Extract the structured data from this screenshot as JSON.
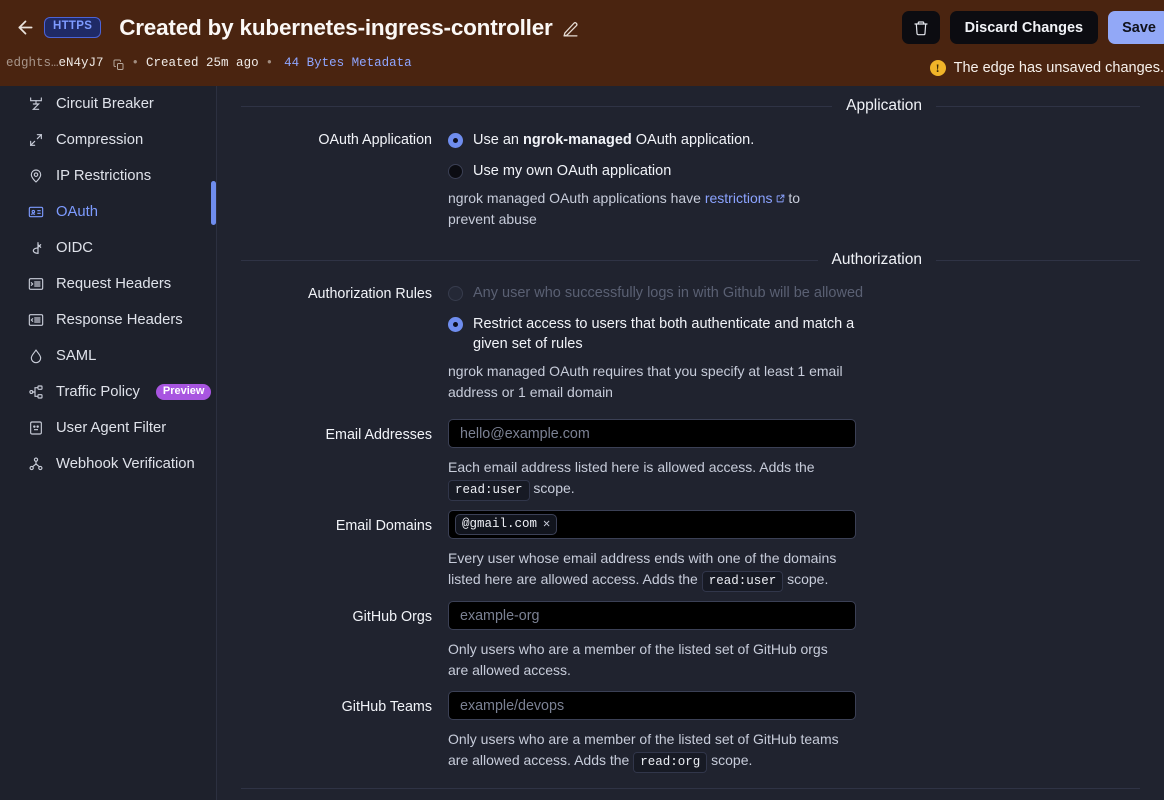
{
  "header": {
    "back_icon": "arrow-left-icon",
    "protocol_badge": "HTTPS",
    "title": "Created by kubernetes-ingress-controller",
    "edit_icon": "pencil-icon",
    "delete_icon": "trash-icon",
    "discard_label": "Discard Changes",
    "save_label": "Save",
    "meta": {
      "id_prefix": "edghts…",
      "id_suffix": "eN4yJ7",
      "copy_icon": "copy-icon",
      "separator": "•",
      "created": "Created 25m ago",
      "metadata_link": "44 Bytes Metadata"
    },
    "unsaved": {
      "icon": "warning-icon",
      "text": "The edge has unsaved changes."
    }
  },
  "sidebar": {
    "items": [
      {
        "label": "Circuit Breaker",
        "icon": "circuit-breaker-icon",
        "active": false,
        "badge": null
      },
      {
        "label": "Compression",
        "icon": "compression-icon",
        "active": false,
        "badge": null
      },
      {
        "label": "IP Restrictions",
        "icon": "location-pin-icon",
        "active": false,
        "badge": null
      },
      {
        "label": "OAuth",
        "icon": "id-card-icon",
        "active": true,
        "badge": null
      },
      {
        "label": "OIDC",
        "icon": "oidc-key-icon",
        "active": false,
        "badge": null
      },
      {
        "label": "Request Headers",
        "icon": "request-headers-icon",
        "active": false,
        "badge": null
      },
      {
        "label": "Response Headers",
        "icon": "response-headers-icon",
        "active": false,
        "badge": null
      },
      {
        "label": "SAML",
        "icon": "saml-shield-icon",
        "active": false,
        "badge": null
      },
      {
        "label": "Traffic Policy",
        "icon": "traffic-policy-icon",
        "active": false,
        "badge": "Preview"
      },
      {
        "label": "User Agent Filter",
        "icon": "user-agent-filter-icon",
        "active": false,
        "badge": null
      },
      {
        "label": "Webhook Verification",
        "icon": "webhook-verification-icon",
        "active": false,
        "badge": null
      }
    ]
  },
  "main": {
    "application_section": {
      "title": "Application",
      "field_label": "OAuth Application",
      "options": [
        {
          "text_prefix": "Use an ",
          "text_bold": "ngrok-managed",
          "text_suffix": " OAuth application.",
          "selected": true
        },
        {
          "text_prefix": "Use my own OAuth application",
          "text_bold": "",
          "text_suffix": "",
          "selected": false
        }
      ],
      "helper_prefix": "ngrok managed OAuth applications have ",
      "helper_link": "restrictions",
      "helper_suffix": " to prevent abuse"
    },
    "authorization_section": {
      "title": "Authorization",
      "rules_label": "Authorization Rules",
      "option_any": "Any user who successfully logs in with Github will be allowed",
      "option_restrict": "Restrict access to users that both authenticate and match a given set of rules",
      "rules_helper": "ngrok managed OAuth requires that you specify at least 1 email address or 1 email domain",
      "fields": [
        {
          "label": "Email Addresses",
          "name": "email-addresses-input",
          "placeholder": "hello@example.com",
          "value": "",
          "chips": [],
          "helper_a": "Each email address listed here is allowed access. Adds the ",
          "scope": "read:user",
          "helper_b": " scope."
        },
        {
          "label": "Email Domains",
          "name": "email-domains-input",
          "placeholder": "",
          "value": "",
          "chips": [
            "@gmail.com"
          ],
          "helper_a": "Every user whose email address ends with one of the domains listed here are allowed access. Adds the ",
          "scope": "read:user",
          "helper_b": " scope."
        },
        {
          "label": "GitHub Orgs",
          "name": "github-orgs-input",
          "placeholder": "example-org",
          "value": "",
          "chips": [],
          "helper_a": "Only users who are a member of the listed set of GitHub orgs are allowed access.",
          "scope": "",
          "helper_b": ""
        },
        {
          "label": "GitHub Teams",
          "name": "github-teams-input",
          "placeholder": "example/devops",
          "value": "",
          "chips": [],
          "helper_a": "Only users who are a member of the listed set of GitHub teams are allowed access. Adds the ",
          "scope": "read:org",
          "helper_b": " scope."
        }
      ]
    }
  },
  "colors": {
    "header_bg": "#4a2410",
    "page_bg": "#20232f",
    "sidebar_bg": "#1e212c",
    "accent_blue": "#7d9bff",
    "save_btn": "#92a8f7",
    "preview_badge": "#a855e0",
    "warning": "#f0b429"
  }
}
